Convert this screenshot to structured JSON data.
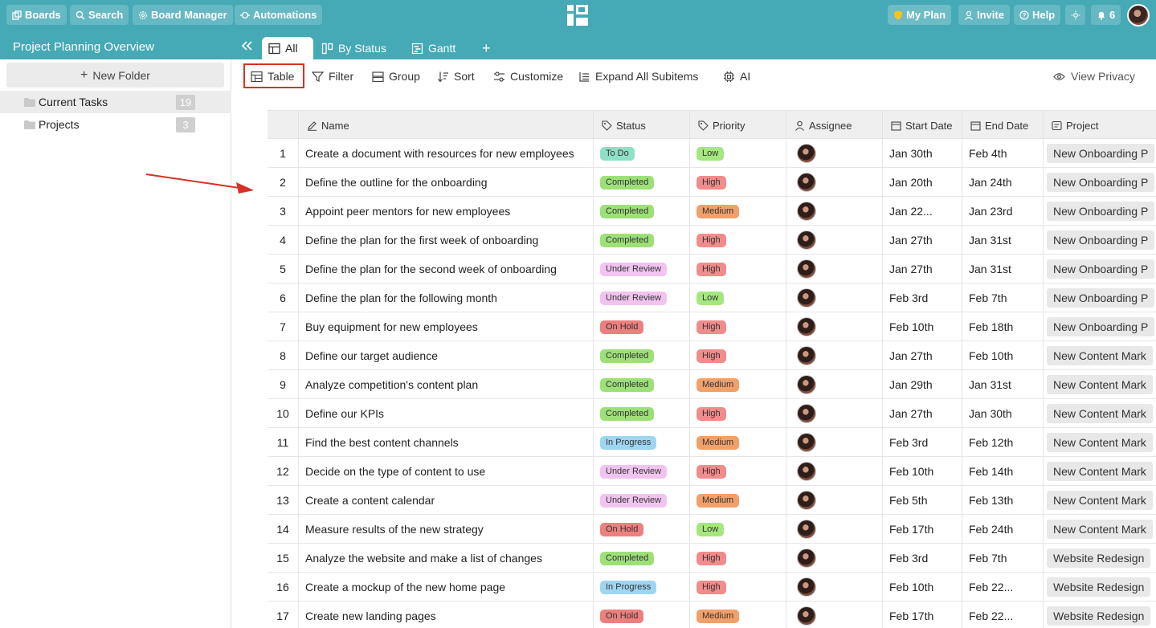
{
  "topbar": {
    "boards": "Boards",
    "search": "Search",
    "board_manager": "Board Manager",
    "automations": "Automations",
    "my_plan": "My Plan",
    "invite": "Invite",
    "help": "Help",
    "notif_count": "6"
  },
  "subbar": {
    "project_title": "Project Planning Overview",
    "tabs": [
      {
        "label": "All"
      },
      {
        "label": "By Status"
      },
      {
        "label": "Gantt"
      }
    ],
    "add_tab": "+"
  },
  "sidebar": {
    "new_folder": "New Folder",
    "new_folder_plus": "+",
    "folders": [
      {
        "label": "Current Tasks",
        "count": "19"
      },
      {
        "label": "Projects",
        "count": "3"
      }
    ]
  },
  "toolbar": {
    "table": "Table",
    "filter": "Filter",
    "group": "Group",
    "sort": "Sort",
    "customize": "Customize",
    "expand": "Expand All Subitems",
    "ai": "AI",
    "view_privacy": "View Privacy"
  },
  "table": {
    "headers": {
      "name": "Name",
      "status": "Status",
      "priority": "Priority",
      "assignee": "Assignee",
      "start": "Start Date",
      "end": "End Date",
      "project": "Project"
    },
    "rows": [
      {
        "num": "1",
        "name": "Create a document with resources for new employees",
        "status": "To Do",
        "priority": "Low",
        "start": "Jan 30th",
        "end": "Feb 4th",
        "project": "New Onboarding P"
      },
      {
        "num": "2",
        "name": "Define the outline for the onboarding",
        "status": "Completed",
        "priority": "High",
        "start": "Jan 20th",
        "end": "Jan 24th",
        "project": "New Onboarding P"
      },
      {
        "num": "3",
        "name": "Appoint peer mentors for new employees",
        "status": "Completed",
        "priority": "Medium",
        "start": "Jan 22...",
        "end": "Jan 23rd",
        "project": "New Onboarding P"
      },
      {
        "num": "4",
        "name": "Define the plan for the first week of onboarding",
        "status": "Completed",
        "priority": "High",
        "start": "Jan 27th",
        "end": "Jan 31st",
        "project": "New Onboarding P"
      },
      {
        "num": "5",
        "name": "Define the plan for the second week of onboarding",
        "status": "Under Review",
        "priority": "High",
        "start": "Jan 27th",
        "end": "Jan 31st",
        "project": "New Onboarding P"
      },
      {
        "num": "6",
        "name": "Define the plan for the following month",
        "status": "Under Review",
        "priority": "Low",
        "start": "Feb 3rd",
        "end": "Feb 7th",
        "project": "New Onboarding P"
      },
      {
        "num": "7",
        "name": "Buy equipment for new employees",
        "status": "On Hold",
        "priority": "High",
        "start": "Feb 10th",
        "end": "Feb 18th",
        "project": "New Onboarding P"
      },
      {
        "num": "8",
        "name": "Define our target audience",
        "status": "Completed",
        "priority": "High",
        "start": "Jan 27th",
        "end": "Feb 10th",
        "project": "New Content Mark"
      },
      {
        "num": "9",
        "name": "Analyze competition's content plan",
        "status": "Completed",
        "priority": "Medium",
        "start": "Jan 29th",
        "end": "Jan 31st",
        "project": "New Content Mark"
      },
      {
        "num": "10",
        "name": "Define our KPIs",
        "status": "Completed",
        "priority": "High",
        "start": "Jan 27th",
        "end": "Jan 30th",
        "project": "New Content Mark"
      },
      {
        "num": "11",
        "name": "Find the best content channels",
        "status": "In Progress",
        "priority": "Medium",
        "start": "Feb 3rd",
        "end": "Feb 12th",
        "project": "New Content Mark"
      },
      {
        "num": "12",
        "name": "Decide on the type of content to use",
        "status": "Under Review",
        "priority": "High",
        "start": "Feb 10th",
        "end": "Feb 14th",
        "project": "New Content Mark"
      },
      {
        "num": "13",
        "name": "Create a content calendar",
        "status": "Under Review",
        "priority": "Medium",
        "start": "Feb 5th",
        "end": "Feb 13th",
        "project": "New Content Mark"
      },
      {
        "num": "14",
        "name": "Measure results of the new strategy",
        "status": "On Hold",
        "priority": "Low",
        "start": "Feb 17th",
        "end": "Feb 24th",
        "project": "New Content Mark"
      },
      {
        "num": "15",
        "name": "Analyze the website and make a list of changes",
        "status": "Completed",
        "priority": "High",
        "start": "Feb 3rd",
        "end": "Feb 7th",
        "project": "Website Redesign"
      },
      {
        "num": "16",
        "name": "Create a mockup of the new home page",
        "status": "In Progress",
        "priority": "High",
        "start": "Feb 10th",
        "end": "Feb 22...",
        "project": "Website Redesign"
      },
      {
        "num": "17",
        "name": "Create new landing pages",
        "status": "On Hold",
        "priority": "Medium",
        "start": "Feb 17th",
        "end": "Feb 22...",
        "project": "Website Redesign"
      }
    ]
  },
  "colors": {
    "brand": "#45a9b6",
    "status": {
      "To Do": "#8fe0c6",
      "Completed": "#9de078",
      "Under Review": "#f1c4ef",
      "On Hold": "#ee7f7f",
      "In Progress": "#9ed6f2"
    },
    "priority": {
      "Low": "#a5e77f",
      "High": "#f28b8b",
      "Medium": "#f2a06a"
    },
    "annotation": "#d93025"
  }
}
